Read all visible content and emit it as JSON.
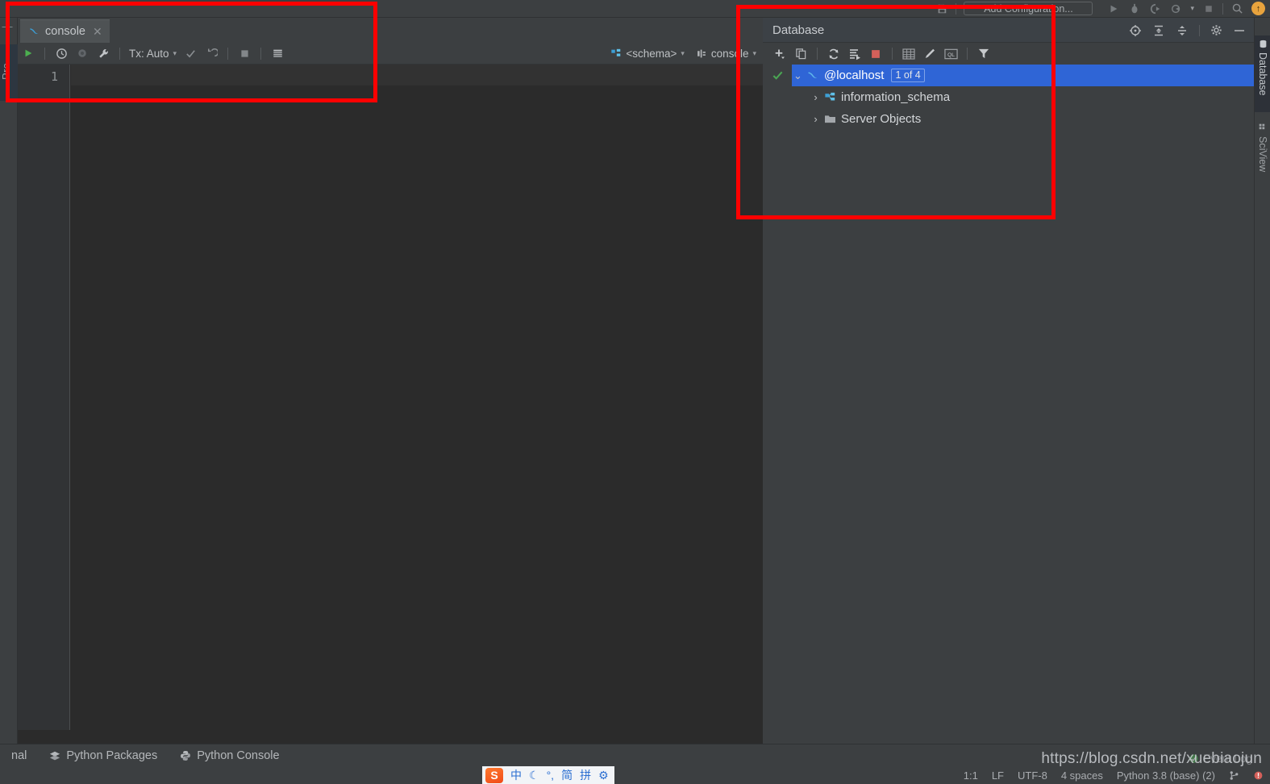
{
  "top_toolbar": {
    "run_configuration": "Add Configuration...",
    "icons": [
      "save-all-icon",
      "run-icon",
      "debug-icon",
      "run-coverage-icon",
      "profile-icon",
      "stop-icon",
      "search-icon",
      "update-badge-icon"
    ],
    "update_badge_glyph": "↑"
  },
  "left_rail": {
    "collapse_glyph": "—",
    "project_tab": "Pro"
  },
  "editor": {
    "tab": {
      "label": "console",
      "icon": "mysql-dolphin-icon",
      "close_glyph": "✕"
    },
    "toolbar": {
      "execute_label": "execute-icon",
      "history_label": "history-icon",
      "pin_label": "pin-icon",
      "wrench_label": "wrench-icon",
      "tx_label": "Tx: Auto",
      "commit_label": "commit-icon",
      "rollback_label": "rollback-icon",
      "stop_label": "stop-icon",
      "table_label": "table-icon",
      "schema_label": "<schema>",
      "schema_icon": "schema-icon",
      "session_label": "console",
      "session_icon": "session-icon",
      "caret_glyph": "⌄"
    },
    "gutter": {
      "line_number": "1"
    },
    "content": ""
  },
  "database_panel": {
    "title": "Database",
    "header_icons": [
      "locate-icon",
      "expand-all-icon",
      "collapse-all-icon",
      "gear-icon",
      "minimize-icon"
    ],
    "toolbar_icons": [
      "add-icon",
      "duplicate-icon",
      "refresh-icon",
      "sync-script-icon",
      "stop-icon",
      "table-editor-icon",
      "modify-icon",
      "ql-console-icon",
      "filter-icon"
    ],
    "tree": [
      {
        "label": "@localhost",
        "icon": "mysql-dolphin-icon",
        "badge": "1 of 4",
        "selected": true,
        "expanded": true,
        "checked": true,
        "indent": 0
      },
      {
        "label": "information_schema",
        "icon": "schema-icon",
        "badge": "",
        "selected": false,
        "expanded": false,
        "checked": false,
        "indent": 1
      },
      {
        "label": "Server Objects",
        "icon": "folder-icon",
        "badge": "",
        "selected": false,
        "expanded": false,
        "checked": false,
        "indent": 1
      }
    ],
    "chevron_expanded": "⌄",
    "chevron_collapsed": "›",
    "check_glyph": "✔"
  },
  "right_rail": {
    "tabs": [
      {
        "label": "Database",
        "icon": "database-icon",
        "active": true
      },
      {
        "label": "SciView",
        "icon": "grid-icon",
        "active": false
      }
    ]
  },
  "bottom_bar": {
    "items": [
      {
        "label": "nal",
        "icon": "terminal-icon"
      },
      {
        "label": "Python Packages",
        "icon": "packages-icon"
      },
      {
        "label": "Python Console",
        "icon": "python-icon"
      }
    ]
  },
  "status_bar": {
    "caret_position": "1:1",
    "line_separator": "LF",
    "encoding": "UTF-8",
    "indent": "4 spaces",
    "interpreter": "Python 3.8 (base) (2)",
    "event_log": "Event Log",
    "watermark": "https://blog.csdn.net/xuebiaojun"
  },
  "ime_bar": {
    "logo": "S",
    "items": [
      "中",
      "☾",
      "°,",
      "简",
      "拼",
      "⚙"
    ]
  },
  "colors": {
    "editor_bg": "#2b2b2b",
    "panel_bg": "#3c3f41",
    "selection_blue": "#2f65d6",
    "annotation_red": "#ff0000",
    "accent_green": "#4aa653",
    "stop_red": "#d4605a",
    "dolphin_blue": "#3c9fd6"
  }
}
